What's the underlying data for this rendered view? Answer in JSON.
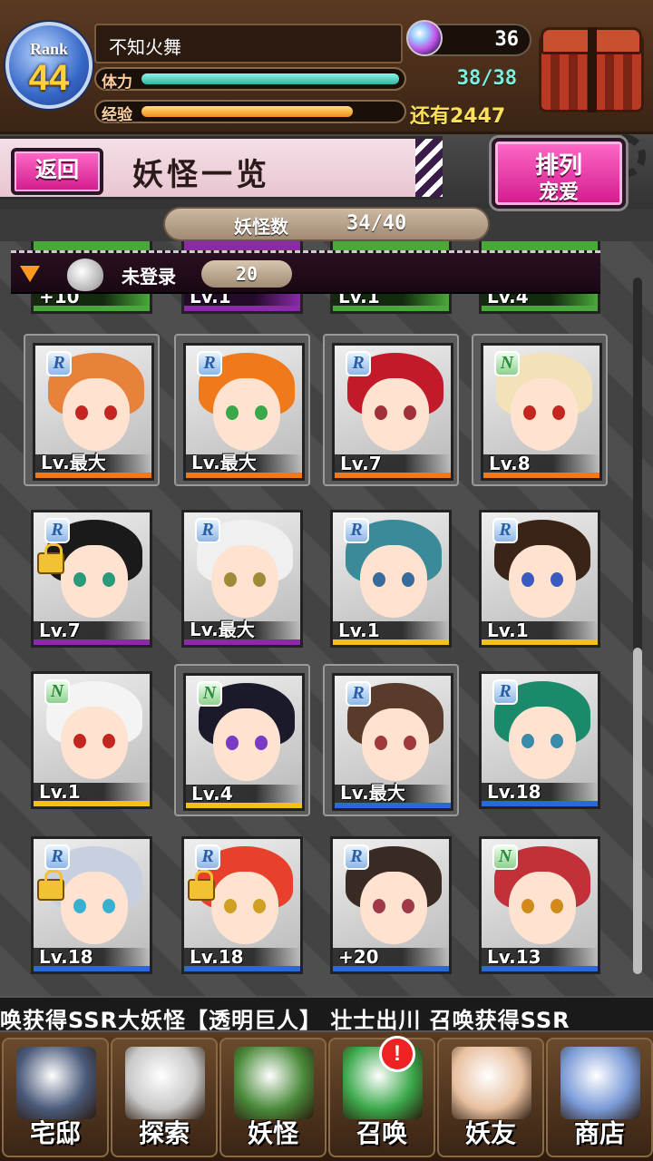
{
  "player": {
    "rank_label": "Rank",
    "rank": "44",
    "name": "不知火舞",
    "stamina_label": "体力",
    "stamina_text": "38/38",
    "stamina_fraction": 1.0,
    "exp_label": "经验",
    "exp_text": "还有2447",
    "exp_fraction": 0.82,
    "gems": "36"
  },
  "header": {
    "back_label": "返回",
    "title": "妖怪一览",
    "sort_line1": "排列",
    "sort_line2": "宠爱"
  },
  "count": {
    "label": "妖怪数",
    "value": "34/40"
  },
  "unregistered": {
    "label": "未登录",
    "count": "20"
  },
  "top_partial_row": [
    {
      "level": "+10",
      "border": "green"
    },
    {
      "level": "Lv.1",
      "border": "purple"
    },
    {
      "level": "Lv.1",
      "border": "green"
    },
    {
      "level": "Lv.4",
      "border": "green"
    }
  ],
  "cards": [
    {
      "rarity": "R",
      "level": "Lv.最大",
      "border": "orange",
      "hair": "#e8823a",
      "eyes": "#c2261e",
      "framed": true,
      "locked": false
    },
    {
      "rarity": "R",
      "level": "Lv.最大",
      "border": "orange",
      "hair": "#f07a1a",
      "eyes": "#3aa84a",
      "framed": true,
      "locked": false
    },
    {
      "rarity": "R",
      "level": "Lv.7",
      "border": "orange",
      "hair": "#c21a2a",
      "eyes": "#a0303a",
      "framed": true,
      "locked": false
    },
    {
      "rarity": "N",
      "level": "Lv.8",
      "border": "orange",
      "hair": "#f3e2b8",
      "eyes": "#c2261e",
      "framed": true,
      "locked": false
    },
    {
      "rarity": "R",
      "level": "Lv.7",
      "border": "purple",
      "hair": "#1a1a1a",
      "eyes": "#2a9a7a",
      "framed": false,
      "locked": true
    },
    {
      "rarity": "R",
      "level": "Lv.最大",
      "border": "purple",
      "hair": "#f0f0f0",
      "eyes": "#a08a3a",
      "framed": false,
      "locked": false
    },
    {
      "rarity": "R",
      "level": "Lv.1",
      "border": "yellow",
      "hair": "#3a8a9a",
      "eyes": "#3a6a9a",
      "framed": false,
      "locked": false
    },
    {
      "rarity": "R",
      "level": "Lv.1",
      "border": "yellow",
      "hair": "#3a2418",
      "eyes": "#3a5ac2",
      "framed": false,
      "locked": false
    },
    {
      "rarity": "N",
      "level": "Lv.1",
      "border": "yellow",
      "hair": "#f4f4f4",
      "eyes": "#c2261e",
      "framed": false,
      "locked": false
    },
    {
      "rarity": "N",
      "level": "Lv.4",
      "border": "yellow",
      "hair": "#1a1a2a",
      "eyes": "#7a3ac2",
      "framed": true,
      "locked": false
    },
    {
      "rarity": "R",
      "level": "Lv.最大",
      "border": "blue",
      "hair": "#5a3a2a",
      "eyes": "#a03a3a",
      "framed": true,
      "locked": false
    },
    {
      "rarity": "R",
      "level": "Lv.18",
      "border": "blue",
      "hair": "#1a8a6a",
      "eyes": "#3a8aaa",
      "framed": false,
      "locked": false
    },
    {
      "rarity": "R",
      "level": "Lv.18",
      "border": "blue",
      "hair": "#c8d0e0",
      "eyes": "#3ab0d0",
      "framed": false,
      "locked": true
    },
    {
      "rarity": "R",
      "level": "Lv.18",
      "border": "blue",
      "hair": "#e8402a",
      "eyes": "#d0a020",
      "framed": false,
      "locked": true
    },
    {
      "rarity": "R",
      "level": "+20",
      "border": "blue",
      "hair": "#3a2a24",
      "eyes": "#a03a4a",
      "framed": false,
      "locked": false
    },
    {
      "rarity": "N",
      "level": "Lv.13",
      "border": "blue",
      "hair": "#c2303a",
      "eyes": "#d08a1a",
      "framed": false,
      "locked": false
    }
  ],
  "ticker": "唤获得SSR大妖怪【透明巨人】 壮士出川 召唤获得SSR",
  "nav": [
    {
      "label": "宅邸",
      "icon": "mansion-icon",
      "color": "#4a5a7a"
    },
    {
      "label": "探索",
      "icon": "magnifier-icon",
      "color": "#c8c8c8"
    },
    {
      "label": "妖怪",
      "icon": "scroll-icon",
      "color": "#4a8a3a"
    },
    {
      "label": "召唤",
      "icon": "pentagram-icon",
      "color": "#3aa84a"
    },
    {
      "label": "妖友",
      "icon": "catgirl-icon",
      "color": "#e8c0a0"
    },
    {
      "label": "商店",
      "icon": "crystal-ball-icon",
      "color": "#7a9ad8"
    }
  ],
  "nav_notify": "!"
}
